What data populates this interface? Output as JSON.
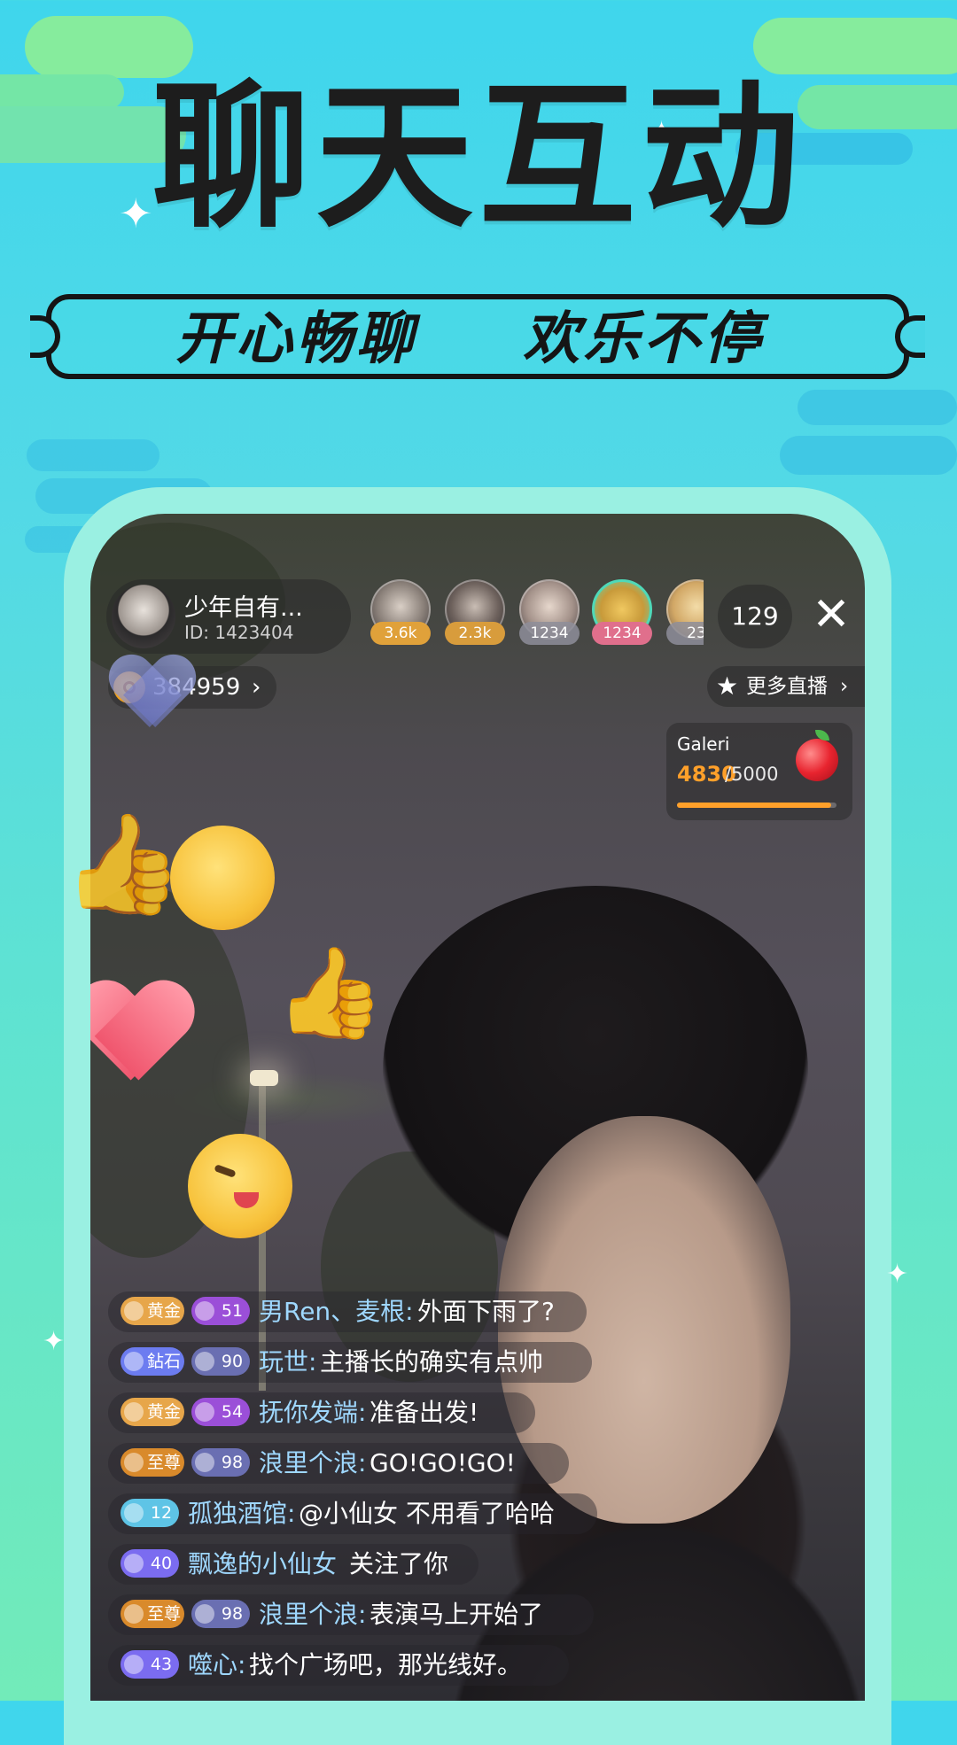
{
  "hero": {
    "title": "聊天互动",
    "banner_left": "开心畅聊",
    "banner_right": "欢乐不停"
  },
  "host": {
    "name": "少年自有...",
    "id_label": "ID: 1423404"
  },
  "viewers": [
    {
      "count": "3.6k",
      "badge_color": "#e0a13a"
    },
    {
      "count": "2.3k",
      "badge_color": "#d89c3c"
    },
    {
      "count": "1234",
      "badge_color": "#8e8e9a"
    },
    {
      "count": "1234",
      "badge_color": "#e06f8c"
    },
    {
      "count": "23",
      "badge_color": "#8e8e9a"
    }
  ],
  "viewer_count": "129",
  "coins": {
    "value": "384959",
    "arrow": "›"
  },
  "more_live": {
    "label": "更多直播",
    "arrow": "›",
    "icon": "star-icon"
  },
  "gift_goal": {
    "name": "Galeri",
    "current": "4830",
    "total": "/5000",
    "progress": 0.966,
    "icon": "apple-icon"
  },
  "chat": [
    {
      "badges": [
        {
          "label": "黄金",
          "color": "#e7a64a"
        },
        {
          "label": "51",
          "color": "#9b4fd8"
        }
      ],
      "name": "男Ren、麦根:",
      "message": "外面下雨了?"
    },
    {
      "badges": [
        {
          "label": "鉆石",
          "color": "#6c7cf0"
        },
        {
          "label": "90",
          "color": "#6a6fb2"
        }
      ],
      "name": "玩世:",
      "message": "主播长的确实有点帅"
    },
    {
      "badges": [
        {
          "label": "黄金",
          "color": "#e7a64a"
        },
        {
          "label": "54",
          "color": "#9b4fd8"
        }
      ],
      "name": "抚你发端:",
      "message": "准备出发!"
    },
    {
      "badges": [
        {
          "label": "至尊",
          "color": "#d98a2b"
        },
        {
          "label": "98",
          "color": "#6a6fb2"
        }
      ],
      "name": "浪里个浪:",
      "message": "GO!GO!GO!"
    },
    {
      "badges": [
        {
          "label": "12",
          "color": "#5ec4e6"
        }
      ],
      "name": "孤独酒馆:",
      "message": "@小仙女 不用看了哈哈"
    },
    {
      "badges": [
        {
          "label": "40",
          "color": "#7b6cf0"
        }
      ],
      "name": "飘逸的小仙女",
      "message": "关注了你"
    },
    {
      "badges": [
        {
          "label": "至尊",
          "color": "#d98a2b"
        },
        {
          "label": "98",
          "color": "#6a6fb2"
        }
      ],
      "name": "浪里个浪:",
      "message": "表演马上开始了"
    },
    {
      "badges": [
        {
          "label": "43",
          "color": "#7b6cf0"
        }
      ],
      "name": "噬心:",
      "message": "找个广场吧，那光线好。"
    }
  ],
  "colors": {
    "background_top": "#3fd6ec",
    "background_bottom": "#72ebb9",
    "phone_frame": "#9af0e2",
    "gift_accent": "#ffa02a",
    "chat_name": "#9fd8ff"
  }
}
